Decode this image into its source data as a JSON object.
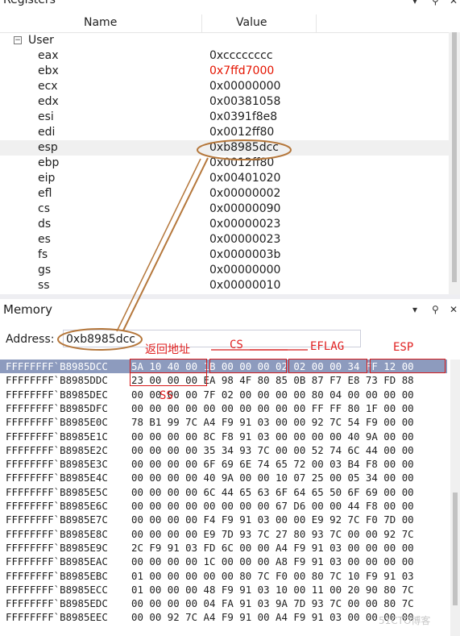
{
  "registers": {
    "title": "Registers",
    "columns": {
      "name": "Name",
      "value": "Value"
    },
    "group": {
      "toggle": "−",
      "label": "User"
    },
    "rows": [
      {
        "name": "eax",
        "value": "0xcccccccc"
      },
      {
        "name": "ebx",
        "value": "0x7ffd7000",
        "changed": true
      },
      {
        "name": "ecx",
        "value": "0x00000000"
      },
      {
        "name": "edx",
        "value": "0x00381058"
      },
      {
        "name": "esi",
        "value": "0x0391f8e8"
      },
      {
        "name": "edi",
        "value": "0x0012ff80"
      },
      {
        "name": "esp",
        "value": "0xb8985dcc",
        "selected": true
      },
      {
        "name": "ebp",
        "value": "0x0012ff80"
      },
      {
        "name": "eip",
        "value": "0x00401020"
      },
      {
        "name": "efl",
        "value": "0x00000002"
      },
      {
        "name": "cs",
        "value": "0x00000090"
      },
      {
        "name": "ds",
        "value": "0x00000023"
      },
      {
        "name": "es",
        "value": "0x00000023"
      },
      {
        "name": "fs",
        "value": "0x0000003b"
      },
      {
        "name": "gs",
        "value": "0x00000000"
      },
      {
        "name": "ss",
        "value": "0x00000010"
      }
    ]
  },
  "memory": {
    "title": "Memory",
    "address_label": "Address:",
    "address_value": "0xb8985dcc",
    "rows": [
      {
        "addr": "FFFFFFFF`B8985DCC",
        "bytes": "5A 10 40 00 1B 00 00 00 02 02 00 00 34 FF 12 00",
        "selected": true
      },
      {
        "addr": "FFFFFFFF`B8985DDC",
        "bytes": "23 00 00 00 EA 98 4F 80 85 0B 87 F7 E8 73 FD 88"
      },
      {
        "addr": "FFFFFFFF`B8985DEC",
        "bytes": "00 00 00 00 7F 02 00 00 00 00 80 04 00 00 00 00"
      },
      {
        "addr": "FFFFFFFF`B8985DFC",
        "bytes": "00 00 00 00 00 00 00 00 00 00 FF FF 80 1F 00 00"
      },
      {
        "addr": "FFFFFFFF`B8985E0C",
        "bytes": "78 B1 99 7C A4 F9 91 03 00 00 92 7C 54 F9 00 00"
      },
      {
        "addr": "FFFFFFFF`B8985E1C",
        "bytes": "00 00 00 00 8C F8 91 03 00 00 00 00 40 9A 00 00"
      },
      {
        "addr": "FFFFFFFF`B8985E2C",
        "bytes": "00 00 00 00 35 34 93 7C 00 00 52 74 6C 44 00 00"
      },
      {
        "addr": "FFFFFFFF`B8985E3C",
        "bytes": "00 00 00 00 6F 69 6E 74 65 72 00 03 B4 F8 00 00"
      },
      {
        "addr": "FFFFFFFF`B8985E4C",
        "bytes": "00 00 00 00 40 9A 00 00 10 07 25 00 05 34 00 00"
      },
      {
        "addr": "FFFFFFFF`B8985E5C",
        "bytes": "00 00 00 00 6C 44 65 63 6F 64 65 50 6F 69 00 00"
      },
      {
        "addr": "FFFFFFFF`B8985E6C",
        "bytes": "00 00 00 00 00 00 00 00 67 D6 00 00 44 F8 00 00"
      },
      {
        "addr": "FFFFFFFF`B8985E7C",
        "bytes": "00 00 00 00 F4 F9 91 03 00 00 E9 92 7C F0 7D 00"
      },
      {
        "addr": "FFFFFFFF`B8985E8C",
        "bytes": "00 00 00 00 E9 7D 93 7C 27 80 93 7C 00 00 92 7C"
      },
      {
        "addr": "FFFFFFFF`B8985E9C",
        "bytes": "2C F9 91 03 FD 6C 00 00 A4 F9 91 03 00 00 00 00"
      },
      {
        "addr": "FFFFFFFF`B8985EAC",
        "bytes": "00 00 00 00 1C 00 00 00 A8 F9 91 03 00 00 00 00"
      },
      {
        "addr": "FFFFFFFF`B8985EBC",
        "bytes": "01 00 00 00 00 00 80 7C F0 00 80 7C 10 F9 91 03"
      },
      {
        "addr": "FFFFFFFF`B8985ECC",
        "bytes": "01 00 00 00 48 F9 91 03 10 00 11 00 20 90 80 7C"
      },
      {
        "addr": "FFFFFFFF`B8985EDC",
        "bytes": "00 00 00 00 04 FA 91 03 9A 7D 93 7C 00 00 80 7C"
      },
      {
        "addr": "FFFFFFFF`B8985EEC",
        "bytes": "00 00 92 7C A4 F9 91 00 A4 F9 91 03 00 00 00 00"
      }
    ]
  },
  "annotations": {
    "return_addr": "返回地址",
    "cs": "CS",
    "eflag": "EFLAG",
    "esp": "ESP",
    "ss": "SS"
  },
  "watermark": "51CTO博客",
  "colors": {
    "annotation": "#d81b1b",
    "callout": "#b5773b",
    "selected_row": "#8d9bbe",
    "changed_value": "#e51400"
  }
}
